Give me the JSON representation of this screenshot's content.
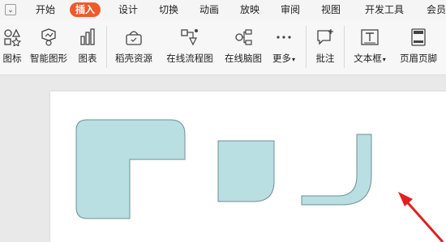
{
  "menubar": {
    "tabs": [
      {
        "label": "开始",
        "active": false
      },
      {
        "label": "插入",
        "active": true
      },
      {
        "label": "设计",
        "active": false
      },
      {
        "label": "切换",
        "active": false
      },
      {
        "label": "动画",
        "active": false
      },
      {
        "label": "放映",
        "active": false
      },
      {
        "label": "审阅",
        "active": false
      },
      {
        "label": "视图",
        "active": false
      },
      {
        "label": "开发工具",
        "active": false
      },
      {
        "label": "会员",
        "active": false
      }
    ]
  },
  "ribbon": {
    "icons": "图标",
    "smartart": "智能图形",
    "chart": "图表",
    "resources": "稻壳资源",
    "flowchart": "在线流程图",
    "mindmap": "在线脑图",
    "more": "更多",
    "comment": "批注",
    "textbox": "文本框",
    "header_footer": "页眉页脚"
  },
  "colors": {
    "active_tab": "#f05a2a",
    "shape_fill": "#b9dfe2",
    "shape_stroke": "#6e8f93",
    "arrow": "#e02020"
  }
}
